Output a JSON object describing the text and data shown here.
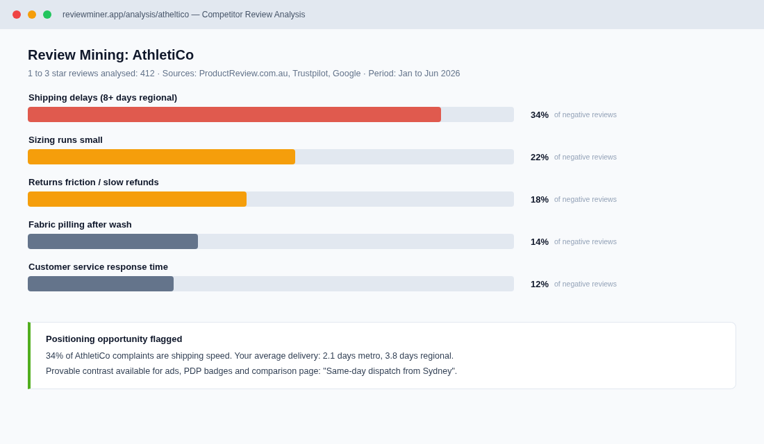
{
  "window": {
    "address": "reviewminer.app/analysis/atheltico — Competitor Review Analysis"
  },
  "title": "Review Mining: AthletiCo",
  "subtitle": "1 to 3 star reviews analysed: 412 · Sources: ProductReview.com.au, Trustpilot, Google · Period: Jan to Jun 2026",
  "themes": [
    {
      "label": "Shipping delays (8+ days regional)",
      "level": 0.85,
      "color": "#e05a4e",
      "percent": "34%",
      "note": "of negative reviews"
    },
    {
      "label": "Sizing runs small",
      "level": 0.55,
      "color": "#f59e0b",
      "percent": "22%",
      "note": "of negative reviews"
    },
    {
      "label": "Returns friction / slow refunds",
      "level": 0.45,
      "color": "#f59e0b",
      "percent": "18%",
      "note": "of negative reviews"
    },
    {
      "label": "Fabric pilling after wash",
      "level": 0.35,
      "color": "#64748b",
      "percent": "14%",
      "note": "of negative reviews"
    },
    {
      "label": "Customer service response time",
      "level": 0.3,
      "color": "#64748b",
      "percent": "12%",
      "note": "of negative reviews"
    }
  ],
  "callout": {
    "title": "Positioning opportunity flagged",
    "lines": [
      "34% of AthletiCo complaints are shipping speed. Your average delivery: 2.1 days metro, 3.8 days regional.",
      "Provable contrast available for ads, PDP badges and comparison page: \"Same-day dispatch from Sydney\"."
    ]
  }
}
